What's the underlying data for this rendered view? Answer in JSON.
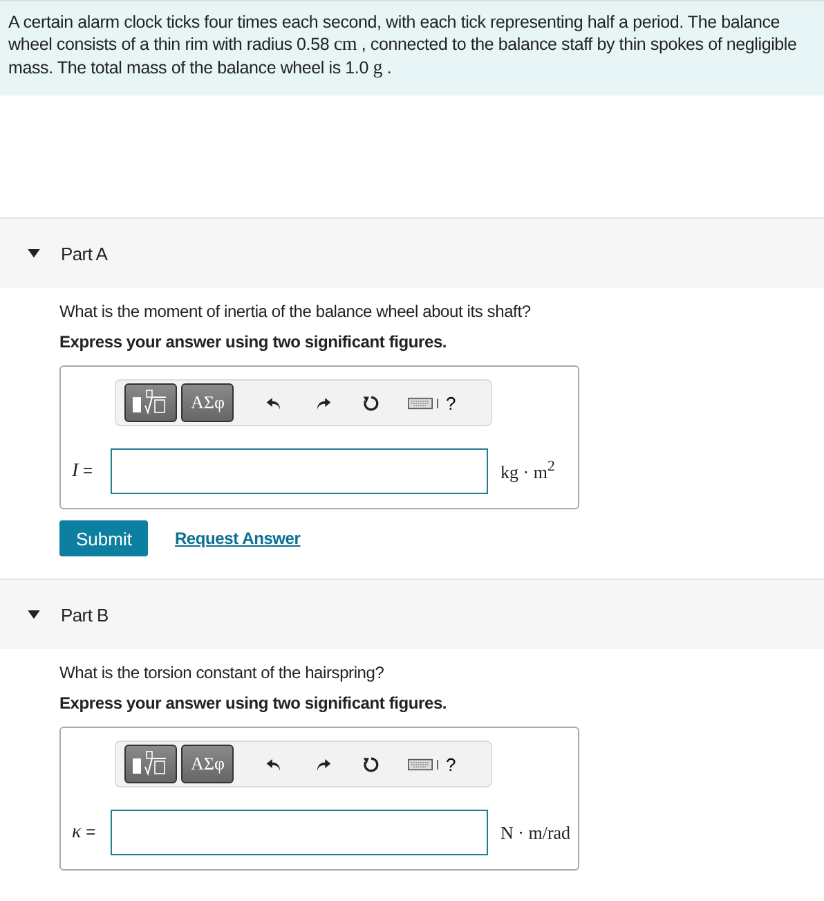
{
  "intro": [
    {
      "kind": "text",
      "text": "A certain alarm clock ticks four times each second, with each tick representing half a period. The balance wheel consists of a thin rim with radius 0.58 "
    },
    {
      "kind": "math",
      "text": "cm"
    },
    {
      "kind": "text",
      "text": " , connected to the balance staff by thin spokes of negligible mass. The total mass of the balance wheel is 1.0 "
    },
    {
      "kind": "math",
      "text": "g"
    },
    {
      "kind": "text",
      "text": " ."
    }
  ],
  "parts": [
    {
      "label": "Part A",
      "expanded": true,
      "question": "What is the moment of inertia of the balance wheel about its shaft?",
      "instruction": "Express your answer using two significant figures.",
      "toolbar": {
        "greek": "ΑΣφ",
        "help": "?"
      },
      "variable": "I",
      "equals": "=",
      "unit": "kg · m$^{2}$",
      "submit": "Submit",
      "request": "Request Answer"
    },
    {
      "label": "Part B",
      "expanded": true,
      "question": "What is the torsion constant of the hairspring?",
      "instruction": "Express your answer using two significant figures.",
      "toolbar": {
        "greek": "ΑΣφ",
        "help": "?"
      },
      "variable": "κ",
      "equals": "=",
      "unit": "N · m/rad"
    }
  ]
}
